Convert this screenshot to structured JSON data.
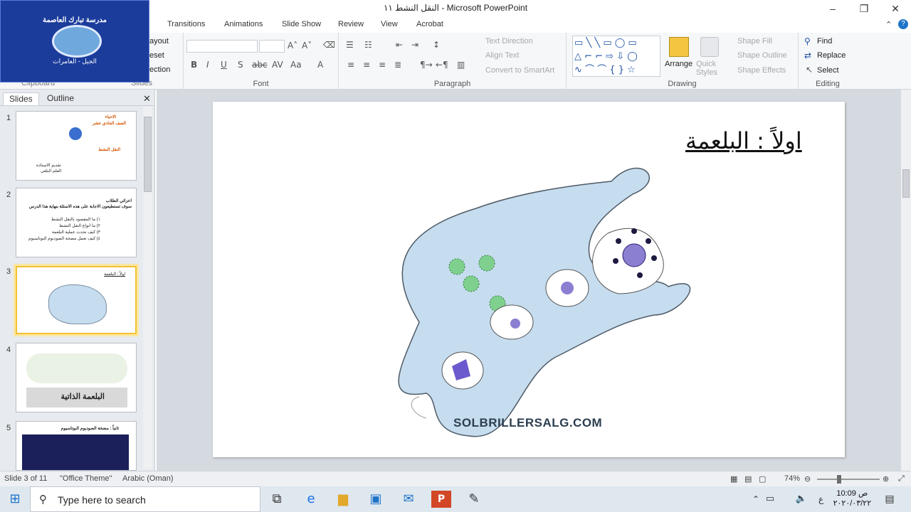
{
  "window": {
    "title": "النقل النشط ١١  -  Microsoft PowerPoint"
  },
  "ribbon_tabs": [
    "Transitions",
    "Animations",
    "Slide Show",
    "Review",
    "View",
    "Acrobat"
  ],
  "logo": {
    "top_text": "مدرسة تبارك العاصمة",
    "bottom_text": "الجيل - العامرات"
  },
  "clipboard_partial": [
    "ayout",
    "eset",
    "ection",
    "Clipboard",
    "Slides"
  ],
  "font_group": {
    "label": "Font",
    "font_name": "",
    "font_size": ""
  },
  "paragraph_group": {
    "label": "Paragraph",
    "text_direction": "Text Direction",
    "align_text": "Align Text",
    "convert_smartart": "Convert to SmartArt"
  },
  "drawing_group": {
    "label": "Drawing",
    "arrange": "Arrange",
    "quick_styles": "Quick Styles",
    "shape_fill": "Shape Fill",
    "shape_outline": "Shape Outline",
    "shape_effects": "Shape Effects"
  },
  "editing_group": {
    "label": "Editing",
    "find": "Find",
    "replace": "Replace",
    "select": "Select"
  },
  "pane": {
    "tab_slides": "Slides",
    "tab_outline": "Outline"
  },
  "thumbnails": [
    {
      "num": "1",
      "lines": [
        "الاحياء",
        "الصف الحادي عشر",
        "النقل النشط",
        "تقديم الاستاذة",
        "العلم البلغي"
      ]
    },
    {
      "num": "2",
      "lines": [
        "اعزائي الطلاب",
        "سوف تستطيعون الاجابة على هذه الاسئلة بنهاية هذا الدرس",
        "١) ما المقصود بالنقل النشط",
        "٢) ما انواع النقل النشط",
        "٣) كيف تحدث عملية البلعمة",
        "٤) كيف تعمل مضخة الصوديوم البوتاسيوم"
      ]
    },
    {
      "num": "3",
      "lines": [
        "اولاً : البلعمة"
      ]
    },
    {
      "num": "4",
      "lines": [
        "البلعمة الذاتية"
      ]
    },
    {
      "num": "5",
      "lines": [
        "ثانياً : مضخة الصوديوم البوتاسيوم"
      ]
    }
  ],
  "slide": {
    "title": "اولاً  :  البلعمة",
    "watermark": "SOLBRILLERSALG.COM"
  },
  "status": {
    "slide_info": "Slide 3 of 11",
    "theme": "\"Office Theme\"",
    "language": "Arabic (Oman)",
    "zoom": "74%"
  },
  "taskbar": {
    "search_placeholder": "Type here to search",
    "time": "10:09 ص",
    "date": "٢٠٢٠/٠٣/٢٢",
    "lang": "ع"
  },
  "colors": {
    "cell": "#c6dcef",
    "vesicle": "#8b7fd1",
    "green": "#7fd08f",
    "ribbon": "#f6f7f9"
  }
}
